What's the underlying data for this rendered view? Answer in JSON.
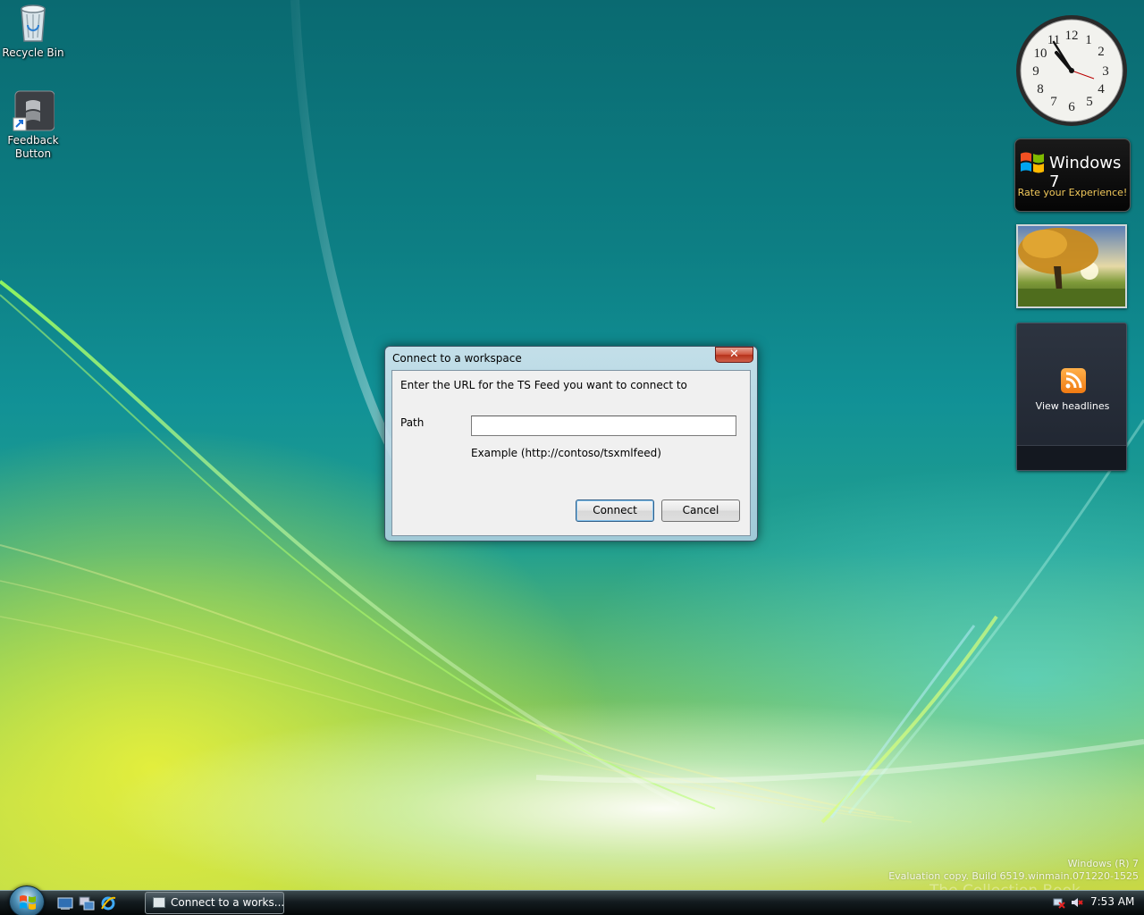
{
  "desktop": {
    "icons": [
      {
        "label": "Recycle Bin"
      },
      {
        "label_line1": "Feedback",
        "label_line2": "Button"
      }
    ]
  },
  "gadgets": {
    "clock_numbers": [
      "12",
      "1",
      "2",
      "3",
      "4",
      "5",
      "6",
      "7",
      "8",
      "9",
      "10",
      "11"
    ],
    "win7_title": "Windows 7",
    "win7_subtitle": "Rate your Experience!",
    "feed_label": "View headlines"
  },
  "dialog": {
    "title": "Connect to a workspace",
    "close_glyph": "✕",
    "instruction": "Enter the URL for the TS Feed you want to connect to",
    "path_label": "Path",
    "path_value": "",
    "example": "Example (http://contoso/tsxmlfeed)",
    "connect_label": "Connect",
    "cancel_label": "Cancel"
  },
  "watermark": {
    "line1": "Windows (R) 7",
    "line2": "Evaluation copy. Build 6519.winmain.071220-1525",
    "overlay": "The Collection Book"
  },
  "taskbar": {
    "task_label": "Connect to a works...",
    "time": "7:53 AM"
  },
  "colors": {
    "dialog_client_bg": "#f0f0f0",
    "close_button": "#c8432b",
    "gadget_text_gold": "#f1c85a",
    "rss_orange": "#f07a12"
  }
}
